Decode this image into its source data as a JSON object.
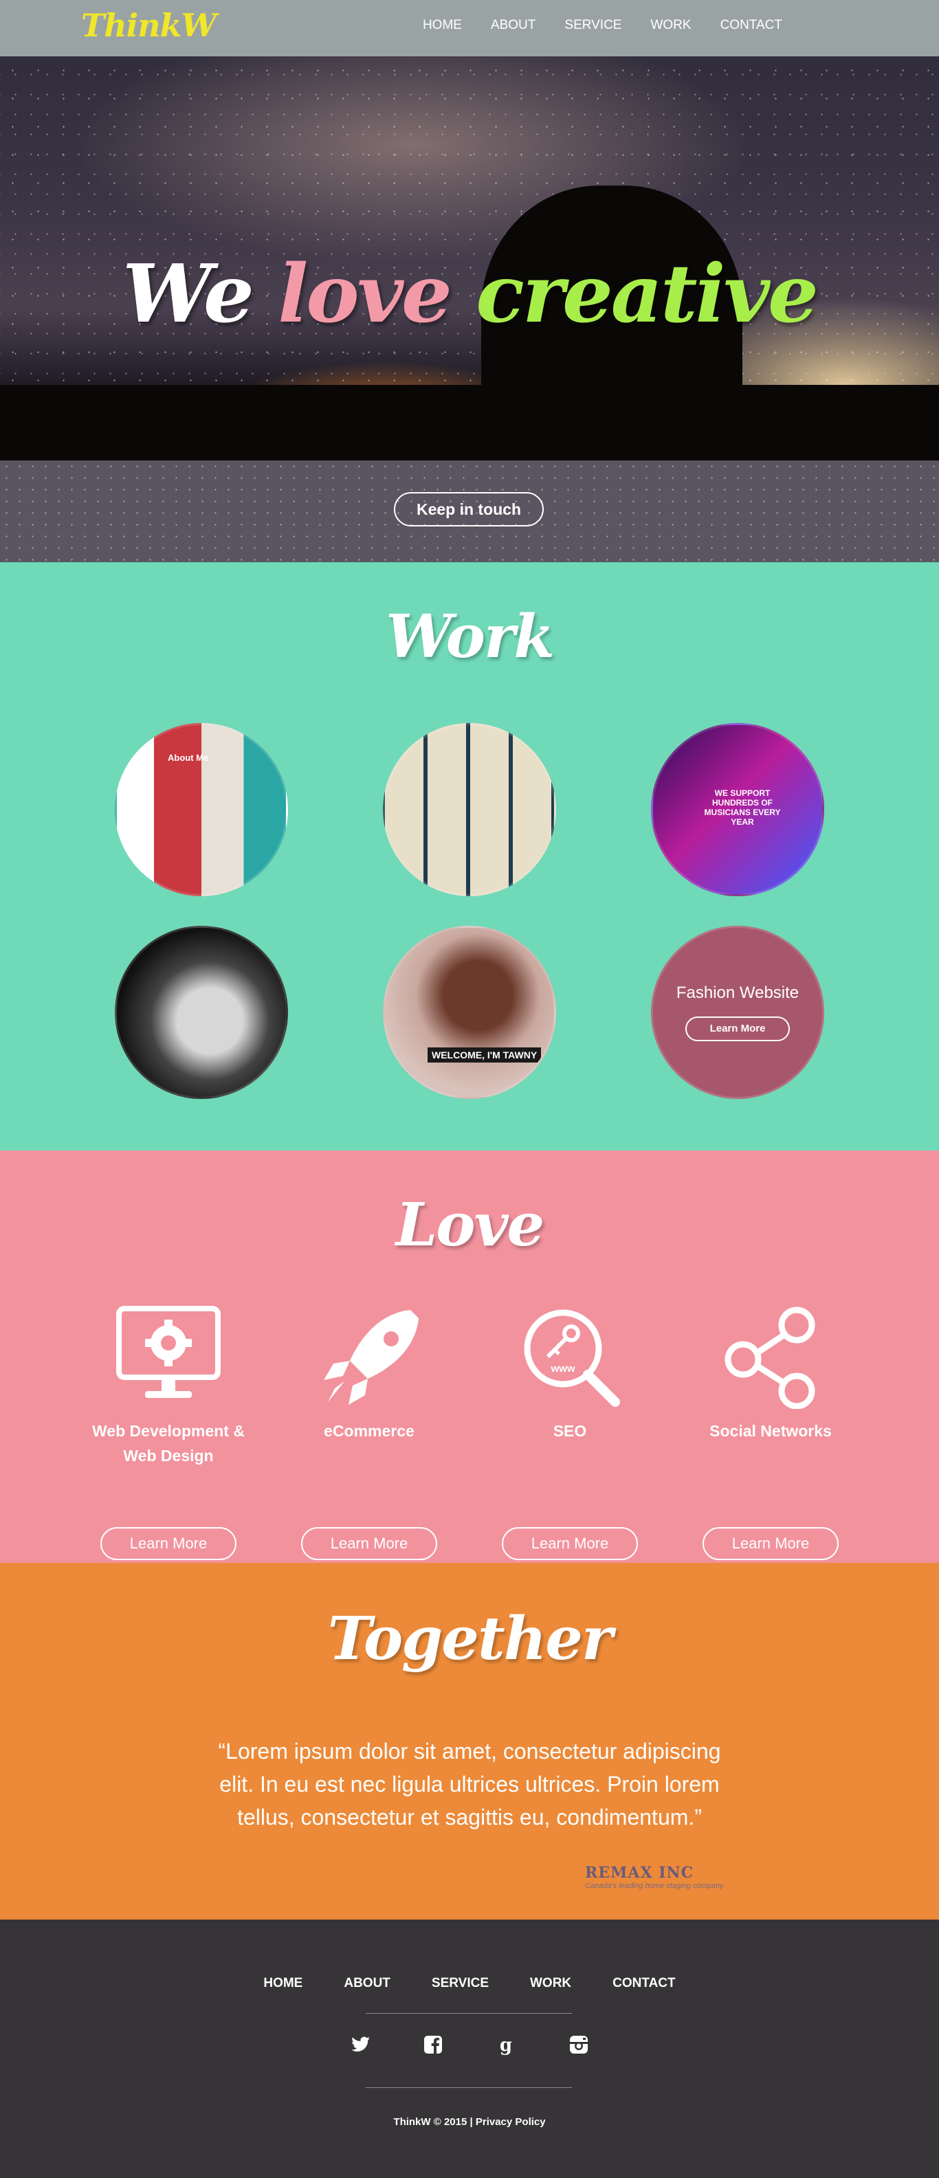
{
  "nav": {
    "logo": "ThinkW",
    "links": [
      "HOME",
      "ABOUT",
      "SERVICE",
      "WORK",
      "CONTACT"
    ]
  },
  "hero": {
    "title_words": [
      "We",
      "love",
      "creative"
    ],
    "button_label": "Keep in touch"
  },
  "work": {
    "title": "Work",
    "items": [
      {
        "label": "About Me"
      },
      {
        "label": ""
      },
      {
        "label": "WE SUPPORT HUNDREDS OF MUSICIANS EVERY YEAR"
      },
      {
        "label": ""
      },
      {
        "label": "WELCOME, I'M TAWNY"
      },
      {
        "label": "Fashion Website",
        "button": "Learn More"
      }
    ]
  },
  "love": {
    "title": "Love",
    "services": [
      {
        "label": "Web Development & Web Design",
        "icon": "monitor-gear-icon",
        "button": "Learn More"
      },
      {
        "label": "eCommerce",
        "icon": "rocket-icon",
        "button": "Learn More"
      },
      {
        "label": "SEO",
        "icon": "search-key-icon",
        "button": "Learn More"
      },
      {
        "label": "Social Networks",
        "icon": "share-icon",
        "button": "Learn More"
      }
    ]
  },
  "together": {
    "title": "Together",
    "quote": "“Lorem ipsum dolor sit amet, consectetur adipiscing elit. In eu est nec ligula ultrices ultrices. Proin lorem tellus, consectetur et sagittis eu, condimentum.”",
    "client_name": "REMAX INC",
    "client_sub": "Canada's leading home staging company"
  },
  "footer": {
    "links": [
      "HOME",
      "ABOUT",
      "SERVICE",
      "WORK",
      "CONTACT"
    ],
    "social": [
      "twitter-icon",
      "facebook-icon",
      "google-plus-icon",
      "instagram-icon"
    ],
    "copyright": "ThinkW © 2015 | Privacy Policy"
  },
  "colors": {
    "work_bg": "#6fd9b8",
    "love_bg": "#f2929d",
    "together_bg": "#ec8a39",
    "footer_bg": "#363436",
    "logo": "#f0e62a"
  }
}
